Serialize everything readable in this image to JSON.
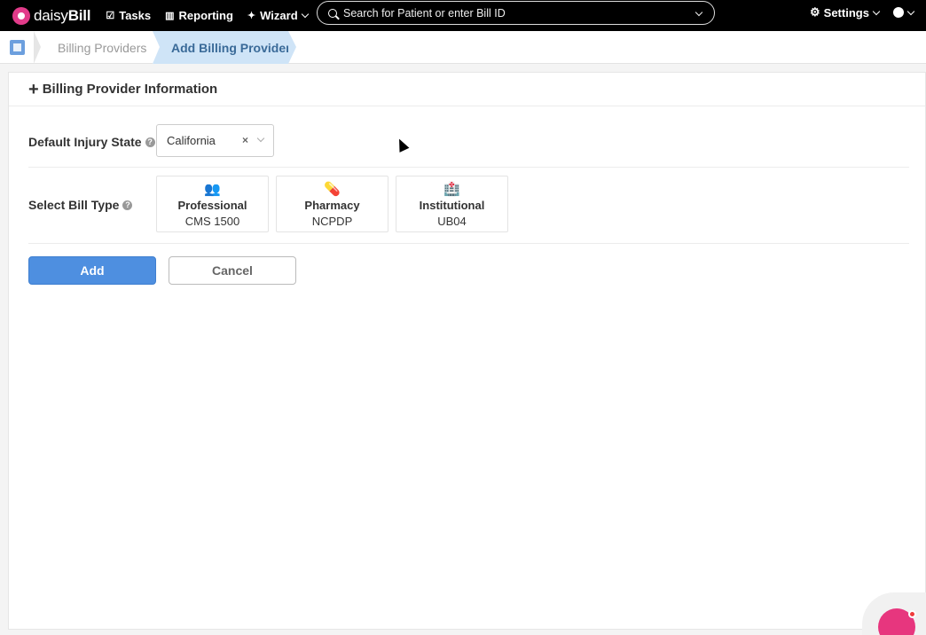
{
  "nav": {
    "logo_text_light": "daisy",
    "logo_text_bold": "Bill",
    "tasks": "Tasks",
    "reporting": "Reporting",
    "wizard": "Wizard",
    "search_placeholder": "Search for Patient or enter Bill ID",
    "settings": "Settings"
  },
  "breadcrumb": {
    "items": [
      "Billing Providers",
      "Add Billing Provider"
    ]
  },
  "panel": {
    "title": "Billing Provider Information"
  },
  "form": {
    "injury_state_label": "Default Injury State",
    "injury_state_value": "California",
    "bill_type_label": "Select Bill Type",
    "bill_types": [
      {
        "name": "Professional",
        "code": "CMS 1500",
        "icon": "user-group-icon"
      },
      {
        "name": "Pharmacy",
        "code": "NCPDP",
        "icon": "pill-icon"
      },
      {
        "name": "Institutional",
        "code": "UB04",
        "icon": "hospital-icon"
      }
    ],
    "add_label": "Add",
    "cancel_label": "Cancel"
  },
  "colors": {
    "primary": "#4e8fe0",
    "brand": "#e23b8a",
    "breadcrumb_active_bg": "#cfe4f7"
  }
}
